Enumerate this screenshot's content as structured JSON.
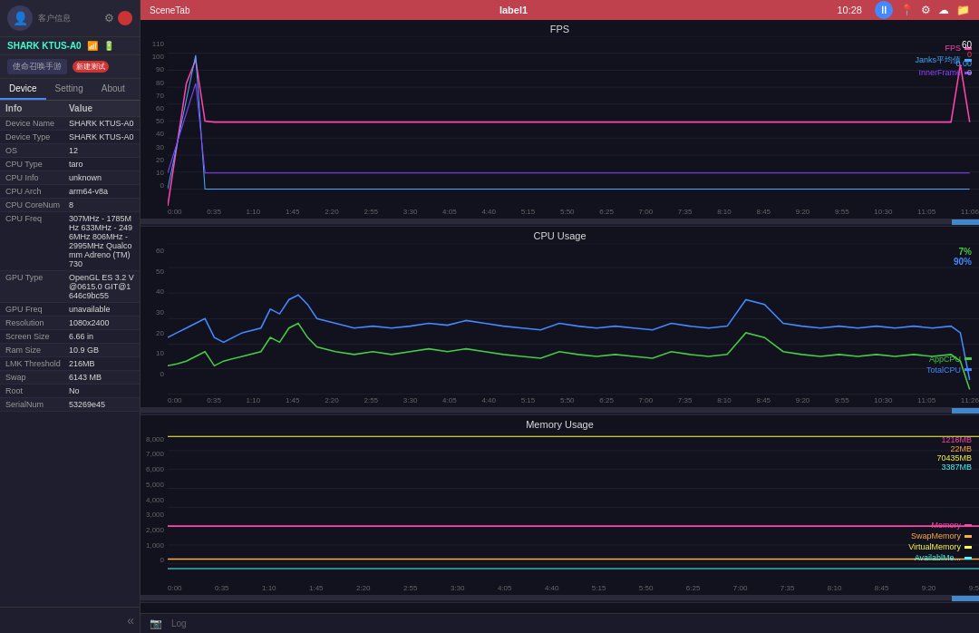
{
  "sidebar": {
    "user_label": "客户信息",
    "device": "SHARK KTUS-A0",
    "tabs": [
      {
        "label": "Device",
        "active": true
      },
      {
        "label": "Setting",
        "active": false
      },
      {
        "label": "About",
        "active": false
      }
    ],
    "table_headers": {
      "col1": "Info",
      "col2": "Value"
    },
    "rows": [
      {
        "info": "Device Name",
        "value": "SHARK KTUS-A0"
      },
      {
        "info": "Device Type",
        "value": "SHARK KTUS-A0"
      },
      {
        "info": "OS",
        "value": "12"
      },
      {
        "info": "CPU Type",
        "value": "taro"
      },
      {
        "info": "CPU Info",
        "value": "unknown"
      },
      {
        "info": "CPU Arch",
        "value": "arm64-v8a"
      },
      {
        "info": "CPU CoreNum",
        "value": "8"
      },
      {
        "info": "CPU Freq",
        "value": "307MHz - 1785MHz\n633MHz - 2496MHz\n806MHz - 2995MHz\nQualcomm Adreno\n(TM) 730"
      },
      {
        "info": "GPU Type",
        "value": "OpenGL ES 3.2\nV@0615.0\nGIT@1646c9bc55"
      },
      {
        "info": "GPU Freq",
        "value": "unavailable"
      },
      {
        "info": "Resolution",
        "value": "1080x2400"
      },
      {
        "info": "Screen Size",
        "value": "6.66 in"
      },
      {
        "info": "Ram Size",
        "value": "10.9 GB"
      },
      {
        "info": "LMK Threshold",
        "value": "216MB"
      },
      {
        "info": "Swap",
        "value": "6143 MB"
      },
      {
        "info": "Root",
        "value": "No"
      },
      {
        "info": "SerialNum",
        "value": "53269e45"
      }
    ],
    "quick_actions": [
      "使命召唤手游",
      "新建测试"
    ]
  },
  "topbar": {
    "scene_tab": "SceneTab",
    "title": "label1",
    "icons": [
      "location",
      "settings",
      "cloud",
      "folder"
    ]
  },
  "time_display": {
    "time": "10:28",
    "val1": "60",
    "val2": "0",
    "val3": "0.00",
    "val4": "0"
  },
  "fps_chart": {
    "title": "FPS",
    "y_labels": [
      "110",
      "100",
      "90",
      "80",
      "70",
      "60",
      "50",
      "40",
      "30",
      "20",
      "10",
      "0"
    ],
    "x_labels": [
      "0:00",
      "0:35",
      "1:10",
      "1:45",
      "2:20",
      "2:55",
      "3:30",
      "4:05",
      "4:40",
      "5:15",
      "5:50",
      "6:25",
      "7:00",
      "7:35",
      "8:10",
      "8:45",
      "9:20",
      "9:55",
      "10:30",
      "11:05",
      "11:06"
    ],
    "legend": [
      {
        "label": "FPS",
        "color": "#ff44aa"
      },
      {
        "label": "Janks平均值",
        "color": "#44aaff"
      },
      {
        "label": "InnerFrame",
        "color": "#8844ff"
      }
    ]
  },
  "cpu_chart": {
    "title": "CPU Usage",
    "y_labels": [
      "60",
      "50",
      "40",
      "30",
      "20",
      "10",
      "0"
    ],
    "x_labels": [
      "0:00",
      "0:35",
      "1:10",
      "1:45",
      "2:20",
      "2:55",
      "3:30",
      "4:05",
      "4:40",
      "5:15",
      "5:50",
      "6:25",
      "7:00",
      "7:35",
      "8:10",
      "8:45",
      "9:20",
      "9:55",
      "10:30",
      "11:05",
      "11:26"
    ],
    "stats": {
      "app": "7%",
      "total": "90%"
    },
    "legend": [
      {
        "label": "AppCPU",
        "color": "#44cc44"
      },
      {
        "label": "TotalCPU",
        "color": "#4488ff"
      }
    ]
  },
  "memory_chart": {
    "title": "Memory Usage",
    "y_labels": [
      "8,000",
      "7,000",
      "6,000",
      "5,000",
      "4,000",
      "3,000",
      "2,000",
      "1,000",
      "0"
    ],
    "x_labels": [
      "0:00",
      "0:35",
      "1:10",
      "1:45",
      "2:20",
      "2:55",
      "3:30",
      "4:05",
      "4:40",
      "5:15",
      "5:50",
      "6:25",
      "7:00",
      "7:35",
      "8:10",
      "8:45",
      "9:20",
      "9:5"
    ],
    "stats": {
      "val1": "1216MB",
      "val2": "22MB",
      "val3": "70435MB",
      "val4": "3387MB"
    },
    "legend": [
      {
        "label": "Memory",
        "color": "#ff44aa"
      },
      {
        "label": "SwapMemory",
        "color": "#ffaa44"
      },
      {
        "label": "VirtualMemory",
        "color": "#ffff44"
      },
      {
        "label": "AvailablMe...",
        "color": "#44ffff"
      }
    ]
  },
  "status_bar": {
    "log_label": "Log"
  }
}
